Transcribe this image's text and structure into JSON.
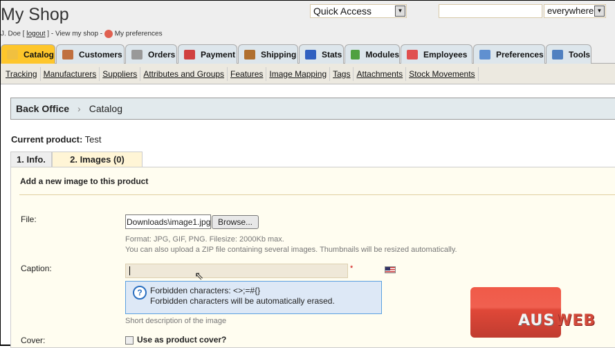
{
  "header": {
    "shop_title": "My Shop",
    "user": "J. Doe",
    "logout": "logout",
    "view_shop": "View my shop",
    "preferences": "My preferences",
    "quick_access": "Quick Access",
    "search_value": "",
    "search_scope": "everywhere"
  },
  "tabs": [
    {
      "label": "Catalog",
      "icon": "folder-icon",
      "color": "#f0c040"
    },
    {
      "label": "Customers",
      "icon": "user-icon",
      "color": "#c07040"
    },
    {
      "label": "Orders",
      "icon": "cart-icon",
      "color": "#999999"
    },
    {
      "label": "Payment",
      "icon": "payment-icon",
      "color": "#d04040"
    },
    {
      "label": "Shipping",
      "icon": "truck-icon",
      "color": "#b07030"
    },
    {
      "label": "Stats",
      "icon": "chart-icon",
      "color": "#3060c0"
    },
    {
      "label": "Modules",
      "icon": "puzzle-icon",
      "color": "#50a040"
    },
    {
      "label": "Employees",
      "icon": "employee-icon",
      "color": "#e05050"
    },
    {
      "label": "Preferences",
      "icon": "pencil-icon",
      "color": "#6090d0"
    },
    {
      "label": "Tools",
      "icon": "wrench-icon",
      "color": "#5080c0"
    }
  ],
  "subnav": [
    "Tracking",
    "Manufacturers",
    "Suppliers",
    "Attributes and Groups",
    "Features",
    "Image Mapping",
    "Tags",
    "Attachments",
    "Stock Movements"
  ],
  "breadcrumb": {
    "root": "Back Office",
    "current": "Catalog"
  },
  "product": {
    "label": "Current product:",
    "name": "Test"
  },
  "product_tabs": [
    "1. Info.",
    "2. Images (0)"
  ],
  "form": {
    "title": "Add a new image to this product",
    "file_label": "File:",
    "file_value": "Downloads\\image1.jpg",
    "browse": "Browse...",
    "format_hint": "Format: JPG, GIF, PNG. Filesize: 2000Kb max.",
    "zip_hint": "You can also upload a ZIP file containing several images. Thumbnails will be resized automatically.",
    "caption_label": "Caption:",
    "caption_value": "",
    "required": "*",
    "forbidden1": "Forbidden characters: <>;=#{}",
    "forbidden2": "Forbidden characters will be automatically erased.",
    "caption_hint": "Short description of the image",
    "cover_label": "Cover:",
    "cover_checkbox": "Use as product cover?",
    "cover_checked": false
  },
  "watermark": "AUSWEB"
}
